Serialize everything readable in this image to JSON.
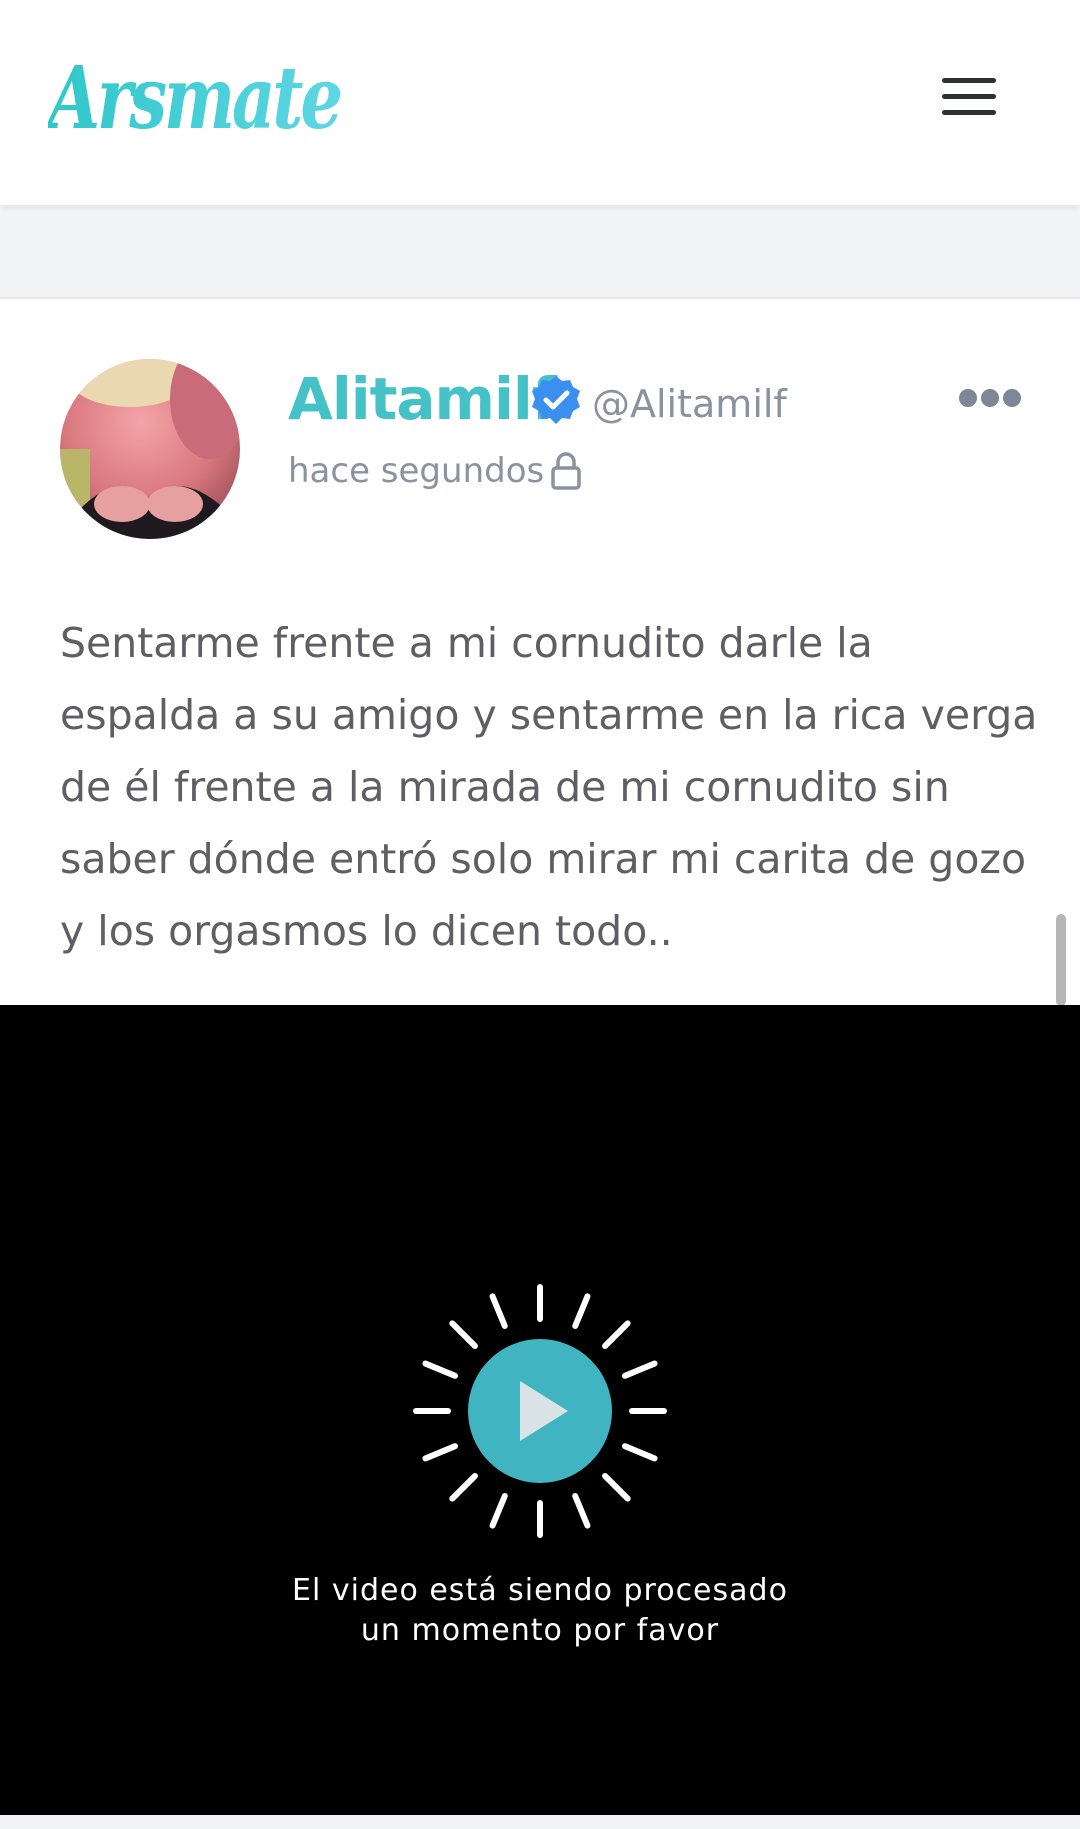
{
  "header": {
    "logo_text": "Arsmate",
    "menu_icon": "hamburger-menu-icon"
  },
  "post": {
    "author": {
      "name": "Alitamilf",
      "handle": "@Alitamilf",
      "verified": true
    },
    "timestamp": "hace segundos",
    "visibility_icon": "lock-icon",
    "options_icon": "more-dots-icon",
    "text": "Sentarme frente a mi cornudito darle la espalda a su amigo y sentarme en la rica verga de él frente a la mirada de mi cornudito sin saber dónde entró solo mirar mi carita de gozo y los orgasmos lo dicen todo.."
  },
  "video": {
    "status_line_1": "El video está siendo procesado",
    "status_line_2": "un momento por favor",
    "icon": "play-icon"
  },
  "colors": {
    "accent": "#44c2c8",
    "verified_blue": "#3b8ff0",
    "muted_text": "#8a92a0",
    "body_text": "#5f5f63"
  }
}
